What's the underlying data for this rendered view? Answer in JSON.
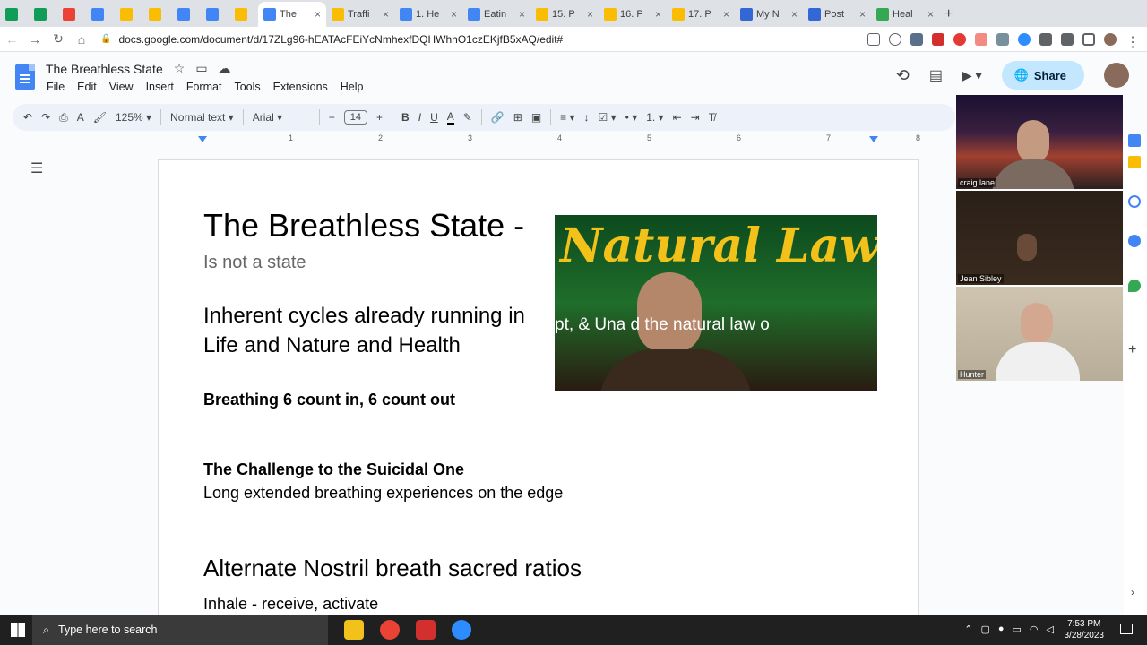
{
  "browser": {
    "tabs": [
      {
        "label": "",
        "color": "#0f9d58",
        "icon": "sheets-icon"
      },
      {
        "label": "",
        "color": "#0f9d58",
        "icon": "sheets-icon"
      },
      {
        "label": "",
        "color": "#ea4335",
        "icon": "gmail-icon"
      },
      {
        "label": "",
        "color": "#4285f4",
        "icon": "docs-icon"
      },
      {
        "label": "",
        "color": "#fbbc04",
        "icon": "drive-icon"
      },
      {
        "label": "",
        "color": "#fbbc04",
        "icon": "drive-icon"
      },
      {
        "label": "",
        "color": "#4285f4",
        "icon": "docs-icon"
      },
      {
        "label": "",
        "color": "#4285f4",
        "icon": "docs-icon"
      },
      {
        "label": "",
        "color": "#fbbc04",
        "icon": "drive-icon"
      },
      {
        "label": "The",
        "color": "#4285f4",
        "icon": "docs-icon",
        "active": true
      },
      {
        "label": "Traffi",
        "color": "#fbbc04",
        "icon": "drive-icon"
      },
      {
        "label": "1. He",
        "color": "#4285f4",
        "icon": "docs-icon"
      },
      {
        "label": "Eatin",
        "color": "#4285f4",
        "icon": "docs-icon"
      },
      {
        "label": "15. P",
        "color": "#fbbc04",
        "icon": "slides-icon"
      },
      {
        "label": "16. P",
        "color": "#fbbc04",
        "icon": "slides-icon"
      },
      {
        "label": "17. P",
        "color": "#fbbc04",
        "icon": "slides-icon"
      },
      {
        "label": "My N",
        "color": "#3367d6",
        "icon": "zoom-icon"
      },
      {
        "label": "Post",
        "color": "#3367d6",
        "icon": "zoom-icon"
      },
      {
        "label": "Heal",
        "color": "#34a853",
        "icon": "rumble-icon"
      }
    ],
    "url": "docs.google.com/document/d/17ZLg96-hEATAcFEiYcNmhexfDQHWhhO1czEKjfB5xAQ/edit#",
    "new_tab": "+"
  },
  "doc": {
    "title": "The Breathless State",
    "menus": [
      "File",
      "Edit",
      "View",
      "Insert",
      "Format",
      "Tools",
      "Extensions",
      "Help"
    ],
    "share_label": "Share"
  },
  "toolbar": {
    "zoom": "125%",
    "style": "Normal text",
    "font": "Arial",
    "font_size": "14"
  },
  "ruler": {
    "ticks": [
      "1",
      "2",
      "3",
      "4",
      "5",
      "6",
      "7",
      "8"
    ]
  },
  "content": {
    "heading": "The Breathless State -",
    "subheading": "Is not a state",
    "cycles": "Inherent cycles already running in Life and Nature and Health",
    "breathing": "Breathing 6 count in, 6 count out",
    "challenge": "The Challenge to the Suicidal One",
    "extended": "Long extended breathing experiences on the edge",
    "alternate": "Alternate Nostril breath sacred ratios",
    "inhale": "Inhale - receive, activate"
  },
  "video": {
    "title": "Natural Law",
    "subtitle": "pt, & Una       d the natural law o"
  },
  "participants": [
    {
      "name": "craig lane"
    },
    {
      "name": "Jean Sibley"
    },
    {
      "name": "Hunter"
    }
  ],
  "taskbar": {
    "search_placeholder": "Type here to search",
    "time": "7:53 PM",
    "date": "3/28/2023"
  }
}
